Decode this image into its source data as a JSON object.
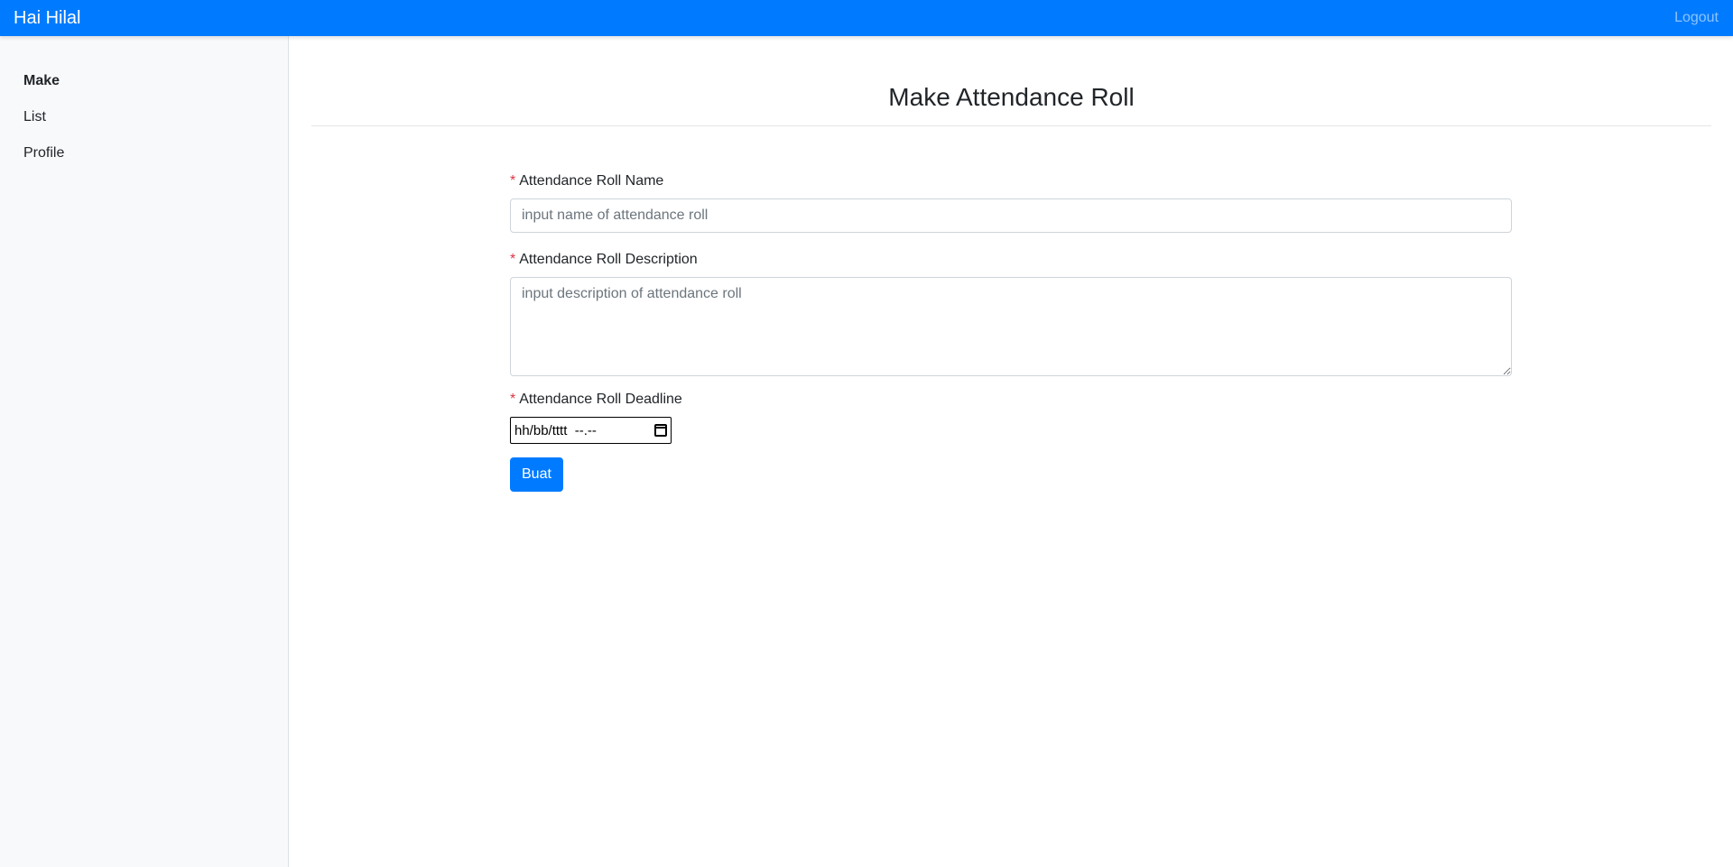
{
  "navbar": {
    "brand": "Hai Hilal",
    "logout_label": "Logout"
  },
  "sidebar": {
    "items": [
      {
        "label": "Make",
        "active": true
      },
      {
        "label": "List",
        "active": false
      },
      {
        "label": "Profile",
        "active": false
      }
    ]
  },
  "main": {
    "title": "Make Attendance Roll"
  },
  "form": {
    "required_marker": "*",
    "name": {
      "label": "Attendance Roll Name",
      "placeholder": "input name of attendance roll",
      "value": ""
    },
    "description": {
      "label": "Attendance Roll Description",
      "placeholder": "input description of attendance roll",
      "value": ""
    },
    "deadline": {
      "label": "Attendance Roll Deadline",
      "display": "hh/bb/tttt  --.--"
    },
    "submit_label": "Buat"
  },
  "colors": {
    "primary": "#007bff",
    "sidebar_bg": "#f8f9fa",
    "required": "#dc3545"
  },
  "icons": {
    "deadline_picker": "calendar-icon"
  }
}
